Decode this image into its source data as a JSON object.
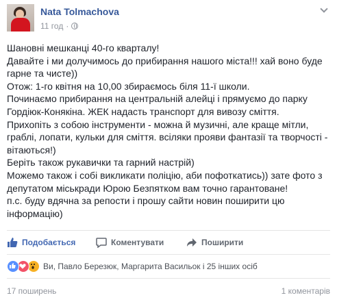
{
  "post": {
    "author": "Nata Tolmachova",
    "time": "11 год",
    "dot": "·",
    "privacy_icon": "globe-icon",
    "menu_icon": "chevron-down-icon",
    "lines": [
      "Шановні мешканці 40-го кварталу!",
      "Давайте і ми долучимось до прибирання нашого міста!!! хай воно буде гарне та чисте))",
      "Отож: 1-го квітня на 10,00 збираємось біля 11-ї школи.",
      "Починаємо прибирання на центральній алейці і прямуємо до парку Гордіюк-Конякіна. ЖЕК надасть транспорт для вивозу сміття.",
      "Прихопіть з собою інструменти - можна й музичні, але краще мітли, граблі, лопати, кульки для сміття. всіляки прояви фантазії та творчості - вітаються!)",
      "Беріть також рукавички та гарний настрій)",
      "Можемо також і собі викликати поліцію, аби пофоткатись)) зате фото з депутатом міськради Юрою Безпятком вам точно гарантоване!",
      "п.с. буду вдячна за репости і прошу сайти новин поширити цю інформацію)"
    ]
  },
  "actions": {
    "like": "Подобається",
    "comment": "Коментувати",
    "share": "Поширити"
  },
  "reactions": {
    "icons": [
      "like-reaction-icon",
      "love-reaction-icon",
      "wow-reaction-icon"
    ],
    "text": "Ви, Павло Березюк, Маргарита Васильок і 25 інших осіб"
  },
  "footer": {
    "shares": "17 поширень",
    "comments": "1 коментарів"
  },
  "colors": {
    "link": "#365899",
    "like_active": "#4267b2",
    "muted": "#90949c"
  }
}
